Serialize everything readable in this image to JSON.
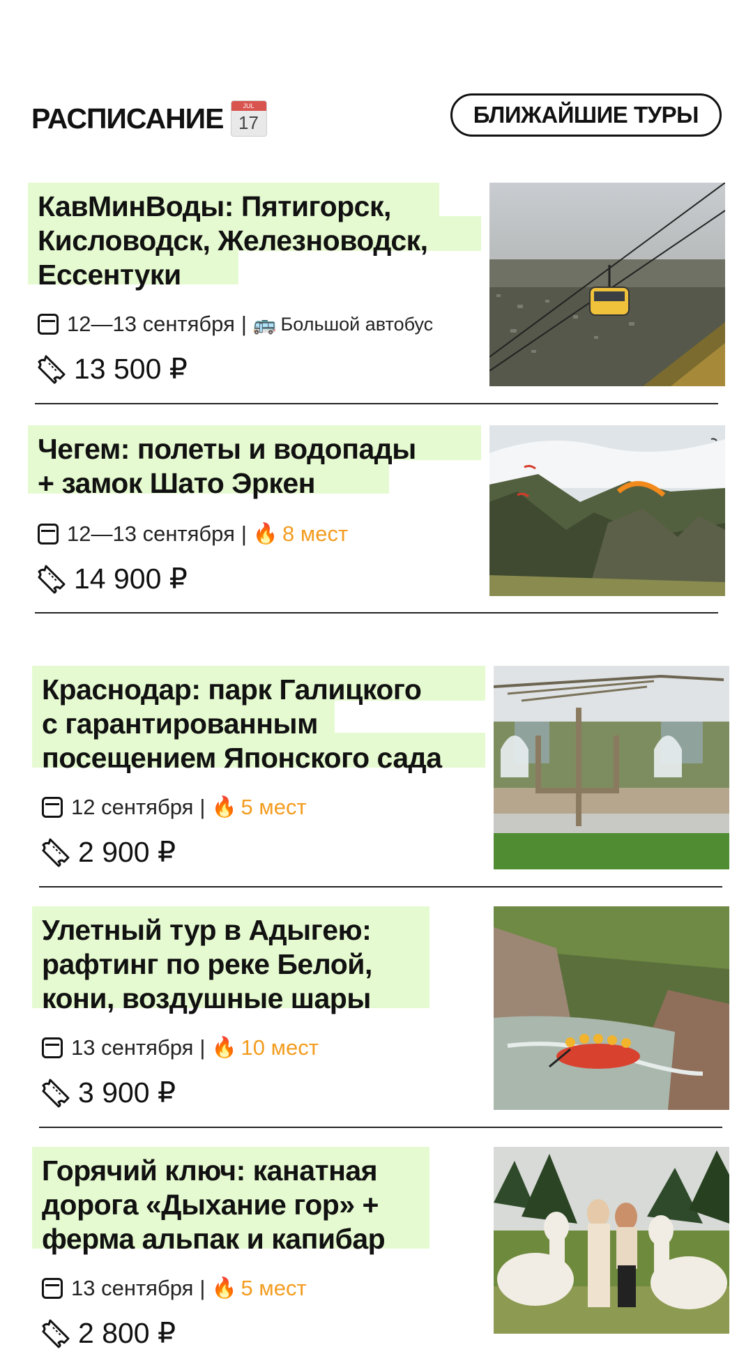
{
  "header": {
    "title": "РАСПИСАНИЕ",
    "calendar_emoji_month": "JUL",
    "calendar_emoji_day": "17",
    "nearest_tours_label": "БЛИЖАЙШИЕ ТУРЫ"
  },
  "tours": [
    {
      "title_lines": [
        "КавМинВоды: Пятигорск,",
        "Кисловодск, Железноводск,",
        "Ессентуки"
      ],
      "dates": "12—13 сентября",
      "separator": "|",
      "extra_emoji": "🚌",
      "extra_text": "Большой автобус",
      "price": "13 500 ₽",
      "photo": "cable-car-photo"
    },
    {
      "title_lines": [
        "Чегем: полеты и водопады",
        "+ замок Шато Эркен"
      ],
      "dates": "12—13 сентября",
      "separator": "|",
      "seats_emoji": "🔥",
      "seats": "8 мест",
      "price": "14 900 ₽",
      "photo": "paragliding-mountains-photo"
    },
    {
      "title_lines": [
        "Краснодар: парк Галицкого",
        "с гарантированным",
        "посещением Японского сада"
      ],
      "dates": "12 сентября",
      "separator": "|",
      "seats_emoji": "🔥",
      "seats": "5 мест",
      "price": "2 900 ₽",
      "photo": "park-tree-arch-photo"
    },
    {
      "title_lines": [
        "Улетный тур в Адыгею:",
        "рафтинг по реке Белой,",
        "кони, воздушные шары"
      ],
      "dates": "13 сентября",
      "separator": "|",
      "seats_emoji": "🔥",
      "seats": "10 мест",
      "price": "3 900 ₽",
      "photo": "river-rafting-photo"
    },
    {
      "title_lines": [
        "Горячий ключ: канатная",
        "дорога «Дыхание гор» +",
        "ферма альпак и капибар"
      ],
      "dates": "13 сентября",
      "separator": "|",
      "seats_emoji": "🔥",
      "seats": "5 мест",
      "price": "2 800 ₽",
      "photo": "alpacas-photo"
    }
  ],
  "colors": {
    "title_highlight": "#e5fad0",
    "seats_orange": "#f39c1f",
    "text": "#111111"
  }
}
